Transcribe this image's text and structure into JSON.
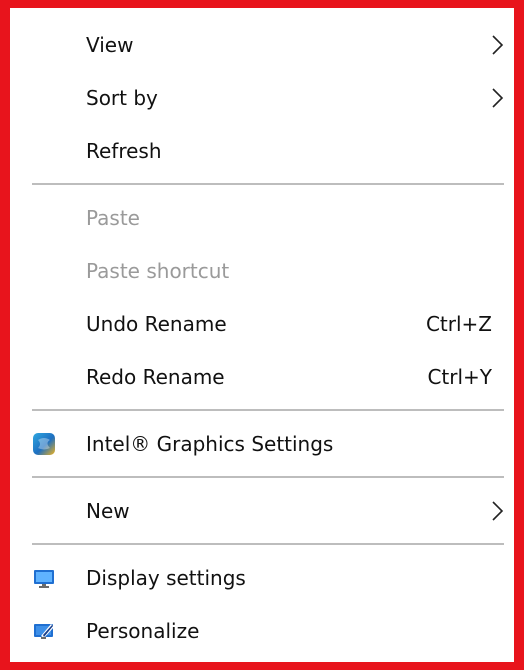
{
  "menu": {
    "view": {
      "label": "View",
      "icon": "chevron-right-icon"
    },
    "sort_by": {
      "label": "Sort by",
      "icon": "chevron-right-icon"
    },
    "refresh": {
      "label": "Refresh"
    },
    "paste": {
      "label": "Paste",
      "enabled": false
    },
    "paste_shortcut": {
      "label": "Paste shortcut",
      "enabled": false
    },
    "undo_rename": {
      "label": "Undo Rename",
      "shortcut": "Ctrl+Z"
    },
    "redo_rename": {
      "label": "Redo Rename",
      "shortcut": "Ctrl+Y"
    },
    "intel_graphics": {
      "label": "Intel® Graphics Settings",
      "icon": "intel-graphics-icon"
    },
    "new": {
      "label": "New",
      "icon": "chevron-right-icon"
    },
    "display_settings": {
      "label": "Display settings",
      "icon": "display-icon"
    },
    "personalize": {
      "label": "Personalize",
      "icon": "personalize-icon"
    }
  },
  "colors": {
    "frame": "#e8141c",
    "text": "#111111",
    "disabled_text": "#9a9a9a",
    "separator": "#bdbdbd"
  }
}
